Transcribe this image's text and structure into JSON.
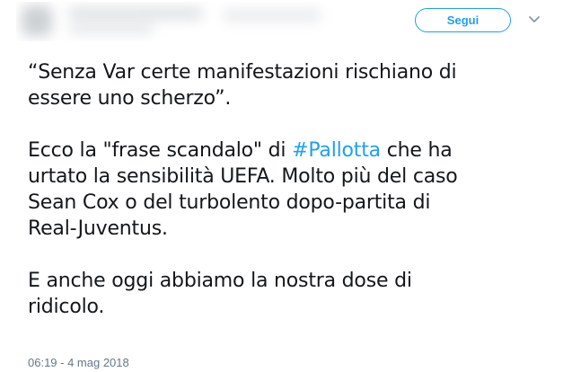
{
  "header": {
    "follow_label": "Segui",
    "menu_icon": "chevron-down-icon"
  },
  "tweet": {
    "paragraphs": [
      [
        "“Senza Var certe manifestazioni rischiano di",
        "essere uno scherzo”."
      ],
      null,
      [
        "Sean Cox o del turbolento dopo-partita di",
        "Real-Juventus."
      ],
      [
        "E anche oggi abbiamo la nostra dose di",
        "ridicolo."
      ]
    ],
    "p2_line1_before": "Ecco la \"frase scandalo\" di ",
    "p2_hashtag": "#Pallotta",
    "p2_line1_after": " che ha",
    "p2_line2": "urtato la sensibilità UEFA. Molto più del caso",
    "timestamp": "06:19 - 4 mag 2018"
  },
  "colors": {
    "accent": "#1da1f2",
    "text": "#14171a",
    "muted": "#657786"
  }
}
